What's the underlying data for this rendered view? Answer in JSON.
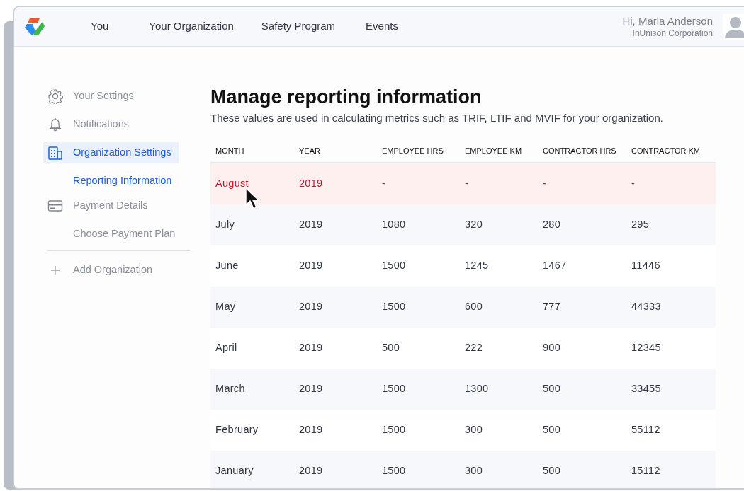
{
  "nav": {
    "items": [
      {
        "label": "You"
      },
      {
        "label": "Your Organization"
      },
      {
        "label": "Safety Program"
      },
      {
        "label": "Events"
      }
    ],
    "user": {
      "greeting": "Hi, Marla Anderson",
      "company": "InUnison Corporation"
    }
  },
  "sidebar": {
    "items": [
      {
        "kind": "settings",
        "label": "Your Settings",
        "selected": false
      },
      {
        "kind": "notifications",
        "label": "Notifications",
        "selected": false
      },
      {
        "kind": "organization",
        "label": "Organization Settings",
        "selected": true
      },
      {
        "kind": "sub",
        "label": "Reporting Information",
        "selected": true
      },
      {
        "kind": "payment",
        "label": "Payment Details",
        "selected": false
      },
      {
        "kind": "sub",
        "label": "Choose Payment Plan",
        "selected": false
      },
      {
        "kind": "divider"
      },
      {
        "kind": "add",
        "label": "Add Organization",
        "selected": false
      }
    ]
  },
  "main": {
    "title": "Manage reporting information",
    "subtitle": "These values are used in calculating metrics such as TRIF, LTIF and MVIF for your organization."
  },
  "table": {
    "columns": [
      "MONTH",
      "YEAR",
      "EMPLOYEE HRS",
      "EMPLOYEE KM",
      "CONTRACTOR HRS",
      "CONTRACTOR KM"
    ],
    "rows": [
      {
        "missing": true,
        "cells": [
          "August",
          "2019",
          "-",
          "-",
          "-",
          "-"
        ]
      },
      {
        "missing": false,
        "cells": [
          "July",
          "2019",
          "1080",
          "320",
          "280",
          "295"
        ]
      },
      {
        "missing": false,
        "cells": [
          "June",
          "2019",
          "1500",
          "1245",
          "1467",
          "11446"
        ]
      },
      {
        "missing": false,
        "cells": [
          "May",
          "2019",
          "1500",
          "600",
          "777",
          "44333"
        ]
      },
      {
        "missing": false,
        "cells": [
          "April",
          "2019",
          "500",
          "222",
          "900",
          "12345"
        ]
      },
      {
        "missing": false,
        "cells": [
          "March",
          "2019",
          "1500",
          "1300",
          "500",
          "33455"
        ]
      },
      {
        "missing": false,
        "cells": [
          "February",
          "2019",
          "1500",
          "300",
          "500",
          "55112"
        ]
      },
      {
        "missing": false,
        "cells": [
          "January",
          "2019",
          "1500",
          "300",
          "500",
          "15112"
        ]
      }
    ]
  }
}
